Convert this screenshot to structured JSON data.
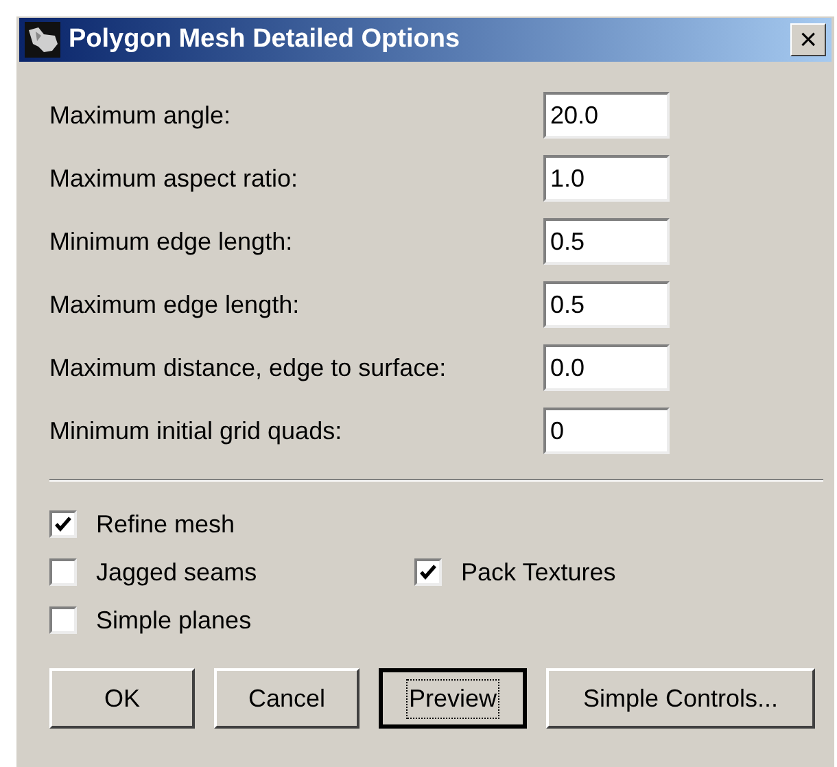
{
  "window": {
    "title": "Polygon Mesh Detailed Options",
    "close": "×"
  },
  "fields": [
    {
      "label": "Maximum angle:",
      "value": "20.0"
    },
    {
      "label": "Maximum aspect ratio:",
      "value": "1.0"
    },
    {
      "label": "Minimum edge length:",
      "value": "0.5"
    },
    {
      "label": "Maximum edge length:",
      "value": "0.5"
    },
    {
      "label": "Maximum distance, edge to surface:",
      "value": "0.0"
    },
    {
      "label": "Minimum initial grid quads:",
      "value": "0"
    }
  ],
  "checkboxes": [
    {
      "label": "Refine mesh",
      "checked": true
    },
    {
      "label": "Jagged seams",
      "checked": false
    },
    {
      "label": "Pack Textures",
      "checked": true
    },
    {
      "label": "Simple planes",
      "checked": false
    }
  ],
  "buttons": [
    {
      "label": "OK",
      "focused": false
    },
    {
      "label": "Cancel",
      "focused": false
    },
    {
      "label": "Preview",
      "focused": true
    },
    {
      "label": "Simple Controls...",
      "focused": false
    }
  ]
}
